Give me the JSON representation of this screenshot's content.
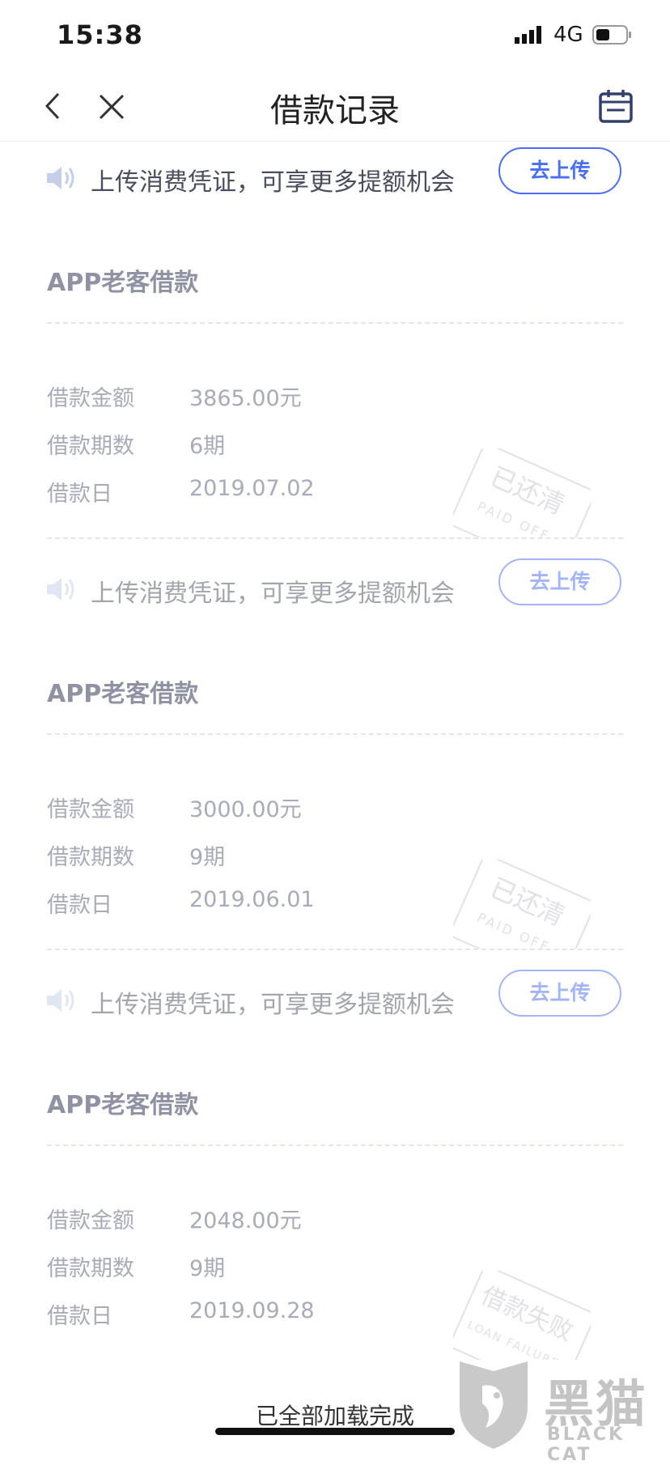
{
  "status_bar": {
    "time": "15:38",
    "network": "4G"
  },
  "nav": {
    "title": "借款记录"
  },
  "banner": {
    "text": "上传消费凭证，可享更多提额机会",
    "button": "去上传"
  },
  "loans": [
    {
      "title": "APP老客借款",
      "rows": [
        {
          "label": "借款金额",
          "value": "3865.00元"
        },
        {
          "label": "借款期数",
          "value": "6期"
        },
        {
          "label": "借款日",
          "value": "2019.07.02"
        }
      ],
      "stamp": {
        "cn": "已还清",
        "en": "PAID OFF"
      }
    },
    {
      "title": "APP老客借款",
      "rows": [
        {
          "label": "借款金额",
          "value": "3000.00元"
        },
        {
          "label": "借款期数",
          "value": "9期"
        },
        {
          "label": "借款日",
          "value": "2019.06.01"
        }
      ],
      "stamp": {
        "cn": "已还清",
        "en": "PAID OFF"
      }
    },
    {
      "title": "APP老客借款",
      "rows": [
        {
          "label": "借款金额",
          "value": "2048.00元"
        },
        {
          "label": "借款期数",
          "value": "9期"
        },
        {
          "label": "借款日",
          "value": "2019.09.28"
        }
      ],
      "stamp": {
        "cn": "借款失败",
        "en": "LOAN FAILURE"
      }
    }
  ],
  "footer": {
    "text": "已全部加载完成"
  },
  "watermark": {
    "cn": "黑猫",
    "en": "BLACK CAT"
  },
  "colors": {
    "accent": "#4a6ef5",
    "muted_text": "#a9abb8",
    "title_text": "#8f92a3"
  }
}
